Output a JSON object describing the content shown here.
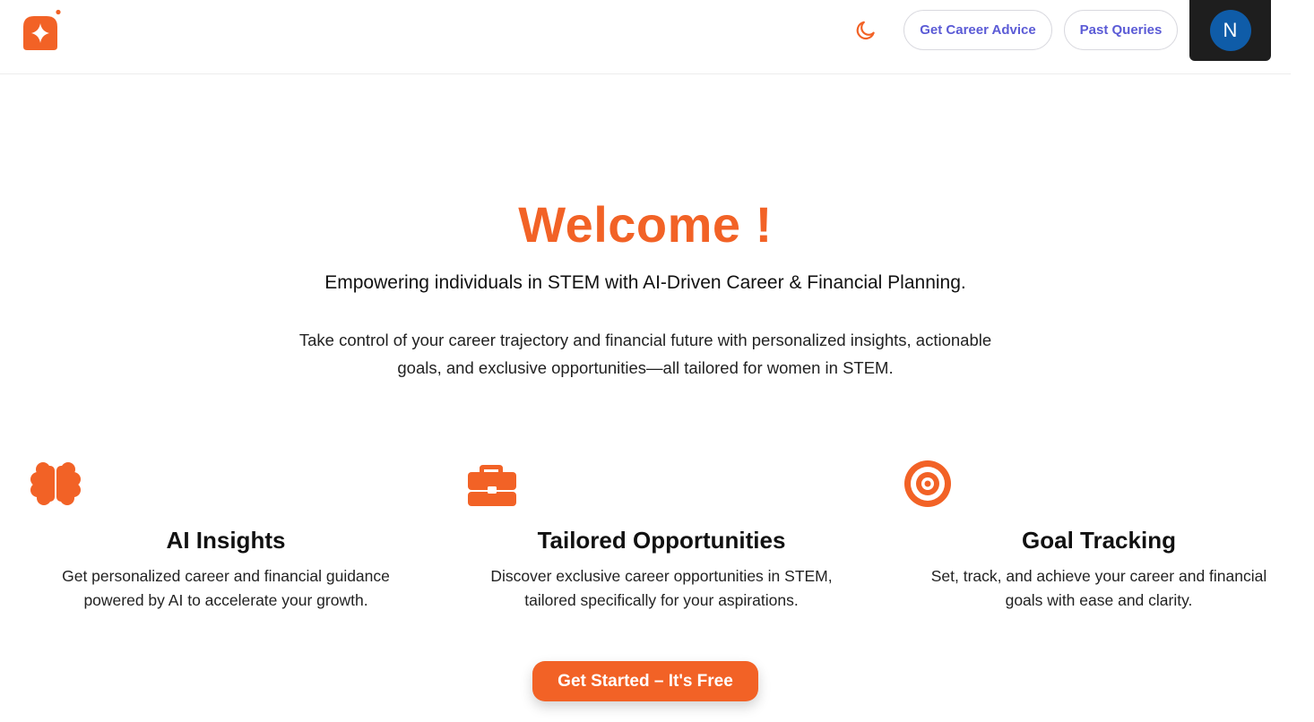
{
  "header": {
    "logo_icon": "sparkle-logo-icon",
    "theme_toggle_icon": "moon-icon",
    "nav": {
      "career_advice": "Get Career Advice",
      "past_queries": "Past Queries"
    },
    "avatar_initial": "N"
  },
  "hero": {
    "title": "Welcome !",
    "subtitle": "Empowering individuals in STEM with AI-Driven Career & Financial Planning.",
    "description": "Take control of your career trajectory and financial future with personalized insights, actionable goals, and exclusive opportunities—all tailored for women in STEM."
  },
  "features": [
    {
      "icon": "brain-icon",
      "title": "AI Insights",
      "description": "Get personalized career and financial guidance powered by AI to accelerate your growth."
    },
    {
      "icon": "briefcase-icon",
      "title": "Tailored Opportunities",
      "description": "Discover exclusive career opportunities in STEM, tailored specifically for your aspirations."
    },
    {
      "icon": "target-icon",
      "title": "Goal Tracking",
      "description": "Set, track, and achieve your career and financial goals with ease and clarity."
    }
  ],
  "cta": {
    "label": "Get Started – It's Free"
  },
  "colors": {
    "accent": "#f26226",
    "nav_text": "#5b5bd6",
    "avatar_bg": "#0f5ca8",
    "avatar_box_bg": "#1e1e1e"
  }
}
